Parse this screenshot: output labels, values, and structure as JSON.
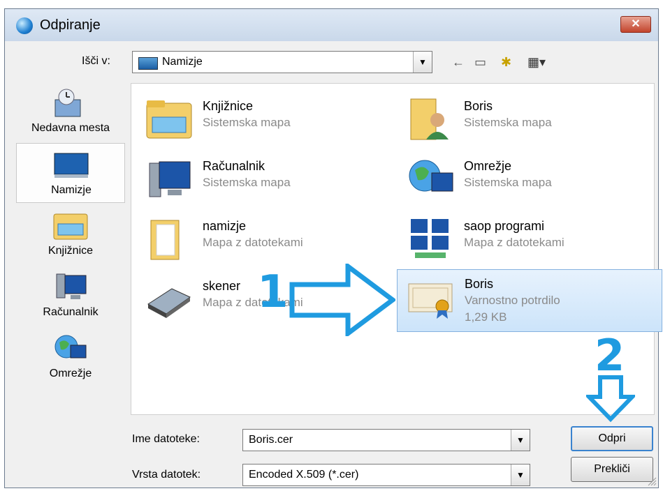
{
  "window": {
    "title": "Odpiranje",
    "close_label": "✕"
  },
  "look_in": {
    "label": "Išči v:",
    "value": "Namizje"
  },
  "toolbar": {
    "back": "←",
    "up": "▭",
    "new_folder": "✱",
    "view": "▦▾"
  },
  "places": [
    {
      "label": "Nedavna mesta",
      "icon": "recent-places-icon"
    },
    {
      "label": "Namizje",
      "icon": "desktop-icon",
      "selected": true
    },
    {
      "label": "Knjižnice",
      "icon": "libraries-icon"
    },
    {
      "label": "Računalnik",
      "icon": "computer-icon"
    },
    {
      "label": "Omrežje",
      "icon": "network-icon"
    }
  ],
  "files": [
    {
      "name": "Knjižnice",
      "type": "Sistemska mapa",
      "icon": "libraries-folder-icon"
    },
    {
      "name": "Boris",
      "type": "Sistemska mapa",
      "icon": "user-folder-icon"
    },
    {
      "name": "Računalnik",
      "type": "Sistemska mapa",
      "icon": "computer-icon"
    },
    {
      "name": "Omrežje",
      "type": "Sistemska mapa",
      "icon": "network-icon"
    },
    {
      "name": "namizje",
      "type": "Mapa z datotekami",
      "icon": "folder-icon"
    },
    {
      "name": "saop programi",
      "type": "Mapa z datotekami",
      "icon": "programs-folder-icon"
    },
    {
      "name": "skener",
      "type": "Mapa z datotekami",
      "icon": "scanner-icon"
    },
    {
      "name": "Boris",
      "type": "Varnostno potrdilo",
      "size": "1,29 KB",
      "icon": "certificate-icon",
      "selected": true
    }
  ],
  "file_name": {
    "label": "Ime datoteke:",
    "value": "Boris.cer"
  },
  "file_type": {
    "label": "Vrsta datotek:",
    "value": "Encoded X.509 (*.cer)"
  },
  "buttons": {
    "open": "Odpri",
    "cancel": "Prekliči"
  },
  "annotations": {
    "step1": "1",
    "step2": "2"
  },
  "colors": {
    "annotation": "#1f9be0",
    "selection": "#cce4fa",
    "close": "#c2442c"
  }
}
